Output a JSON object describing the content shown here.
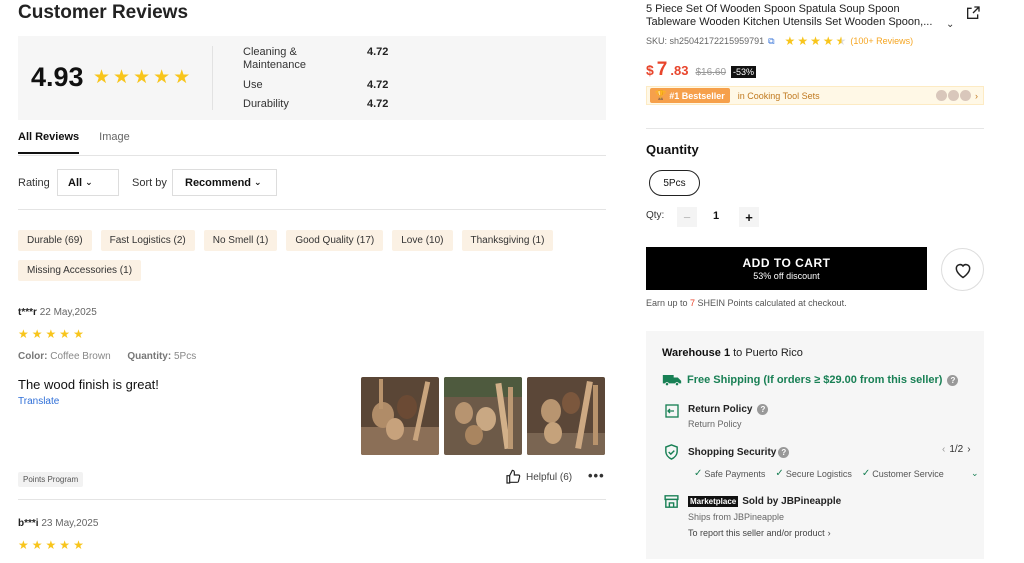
{
  "reviews_header": {
    "title": "Customer Reviews",
    "overall_rating": "4.93",
    "metrics": [
      {
        "label": "Cleaning & Maintenance",
        "value": "4.72"
      },
      {
        "label": "Use",
        "value": "4.72"
      },
      {
        "label": "Durability",
        "value": "4.72"
      }
    ]
  },
  "tabs": [
    {
      "label": "All Reviews",
      "active": true
    },
    {
      "label": "Image",
      "active": false
    }
  ],
  "filters": {
    "rating_label": "Rating",
    "rating_value": "All",
    "sort_label": "Sort by",
    "sort_value": "Recommend"
  },
  "tags": [
    "Durable (69)",
    "Fast Logistics (2)",
    "No Smell (1)",
    "Good Quality (17)",
    "Love (10)",
    "Thanksgiving (1)",
    "Missing Accessories (1)"
  ],
  "reviews": [
    {
      "user": "t***r",
      "date": "22 May,2025",
      "stars": 5,
      "color_label": "Color:",
      "color_value": "Coffee Brown",
      "quantity_label": "Quantity:",
      "quantity_value": "5Pcs",
      "text": "The wood finish is great!",
      "translate": "Translate",
      "badge": "Points Program",
      "helpful": "Helpful (6)"
    },
    {
      "user": "b***i",
      "date": "23 May,2025",
      "stars": 5
    }
  ],
  "product": {
    "title": "5 Piece Set Of Wooden Spoon Spatula Soup Spoon Tableware Wooden Kitchen Utensils Set Wooden Spoon,...",
    "sku": "SKU: sh25042172215959791",
    "rating_stars": 4.5,
    "reviews_count": "(100+ Reviews)",
    "price_currency": "$",
    "price_main": "7",
    "price_cents": ".83",
    "price_old": "$16.60",
    "discount": "-53%",
    "bestseller_label": "#1 Bestseller",
    "bestseller_category": "in Cooking Tool Sets"
  },
  "quantity": {
    "title": "Quantity",
    "option": "5Pcs",
    "qty_label": "Qty:",
    "qty_value": "1",
    "minus": "−",
    "plus": "+"
  },
  "cart": {
    "button_label": "ADD TO CART",
    "button_sub": "53% off discount",
    "earn_prefix": "Earn up to ",
    "earn_points": "7",
    "earn_suffix": " SHEIN Points calculated at checkout."
  },
  "warehouse": {
    "title_prefix": "Warehouse 1",
    "title_suffix": " to Puerto Rico",
    "free_shipping": "Free Shipping (If orders ≥ $29.00 from this seller)",
    "return_title": "Return Policy",
    "return_sub": "Return Policy",
    "security_title": "Shopping Security",
    "security_page": "1/2",
    "security_items": [
      "Safe Payments",
      "Secure Logistics",
      "Customer Service"
    ],
    "marketplace_badge": "Marketplace",
    "seller": "Sold by JBPineapple",
    "ships_from": "Ships from JBPineapple",
    "report": "To report this seller and/or product"
  },
  "colors": {
    "star": "#f8c51c",
    "price": "#e8452c",
    "green": "#198055",
    "tag_bg": "#fbf1e4"
  }
}
